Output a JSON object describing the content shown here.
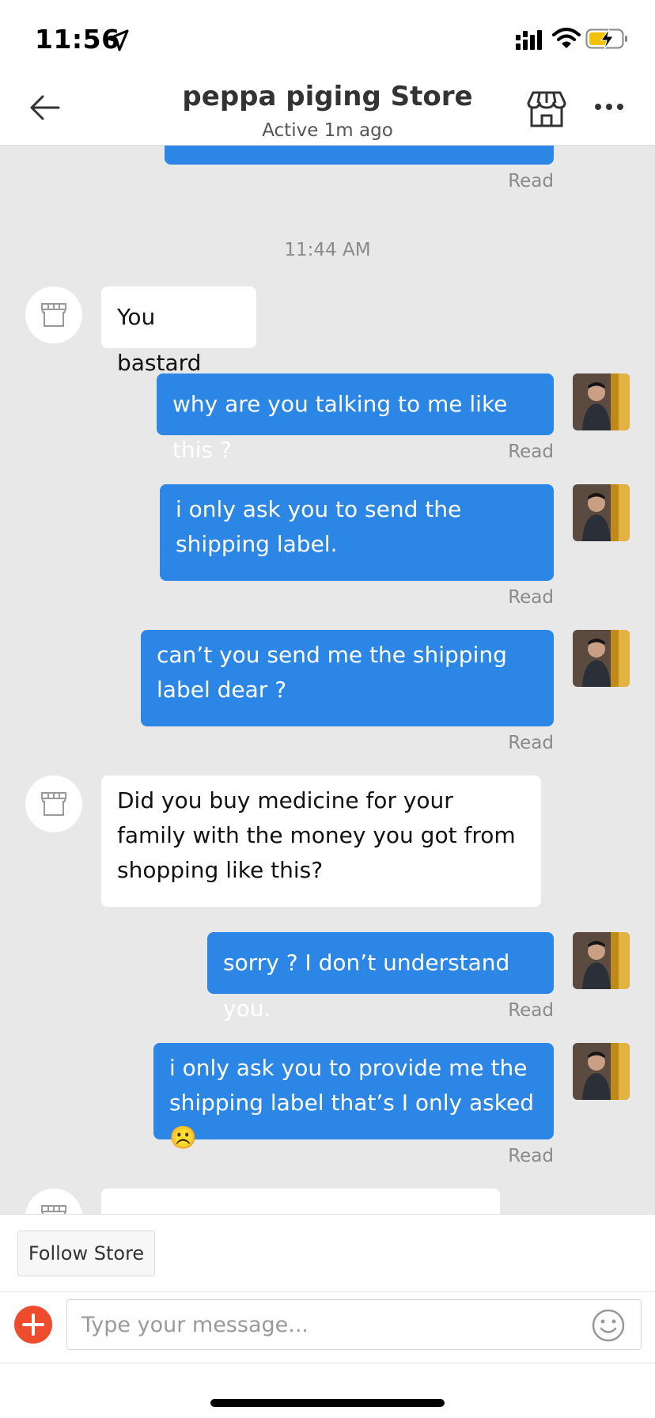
{
  "status_bar": {
    "time": "11:56"
  },
  "header": {
    "title": "peppa piging Store",
    "subtitle": "Active 1m ago"
  },
  "chat": {
    "read_label": "Read",
    "timestamp": "11:44 AM",
    "messages": [
      {
        "from": "store",
        "text": "You bastard"
      },
      {
        "from": "me",
        "text": "why are you talking to me like this ?"
      },
      {
        "from": "me",
        "text": "i only ask you to send the shipping label."
      },
      {
        "from": "me",
        "text": "can’t you send me the shipping label dear ?"
      },
      {
        "from": "store",
        "text": "Did you buy medicine for your family with the money you got from shopping like this?"
      },
      {
        "from": "me",
        "text": "sorry ? I don’t understand you."
      },
      {
        "from": "me",
        "text": "i only ask you to provide me the shipping label that’s I only asked ☹️"
      }
    ]
  },
  "footer": {
    "follow_label": "Follow Store",
    "input_placeholder": "Type your message..."
  },
  "colors": {
    "outgoing_bubble": "#2c86e6",
    "incoming_bubble": "#ffffff",
    "chat_background": "#e8e8e8",
    "accent_add": "#ee4d2d"
  },
  "icons": [
    "location-arrow-icon",
    "signal-icon",
    "wifi-icon",
    "battery-charging-icon",
    "back-arrow-icon",
    "store-icon",
    "more-icon",
    "store-avatar-icon",
    "plus-icon",
    "emoji-icon"
  ]
}
